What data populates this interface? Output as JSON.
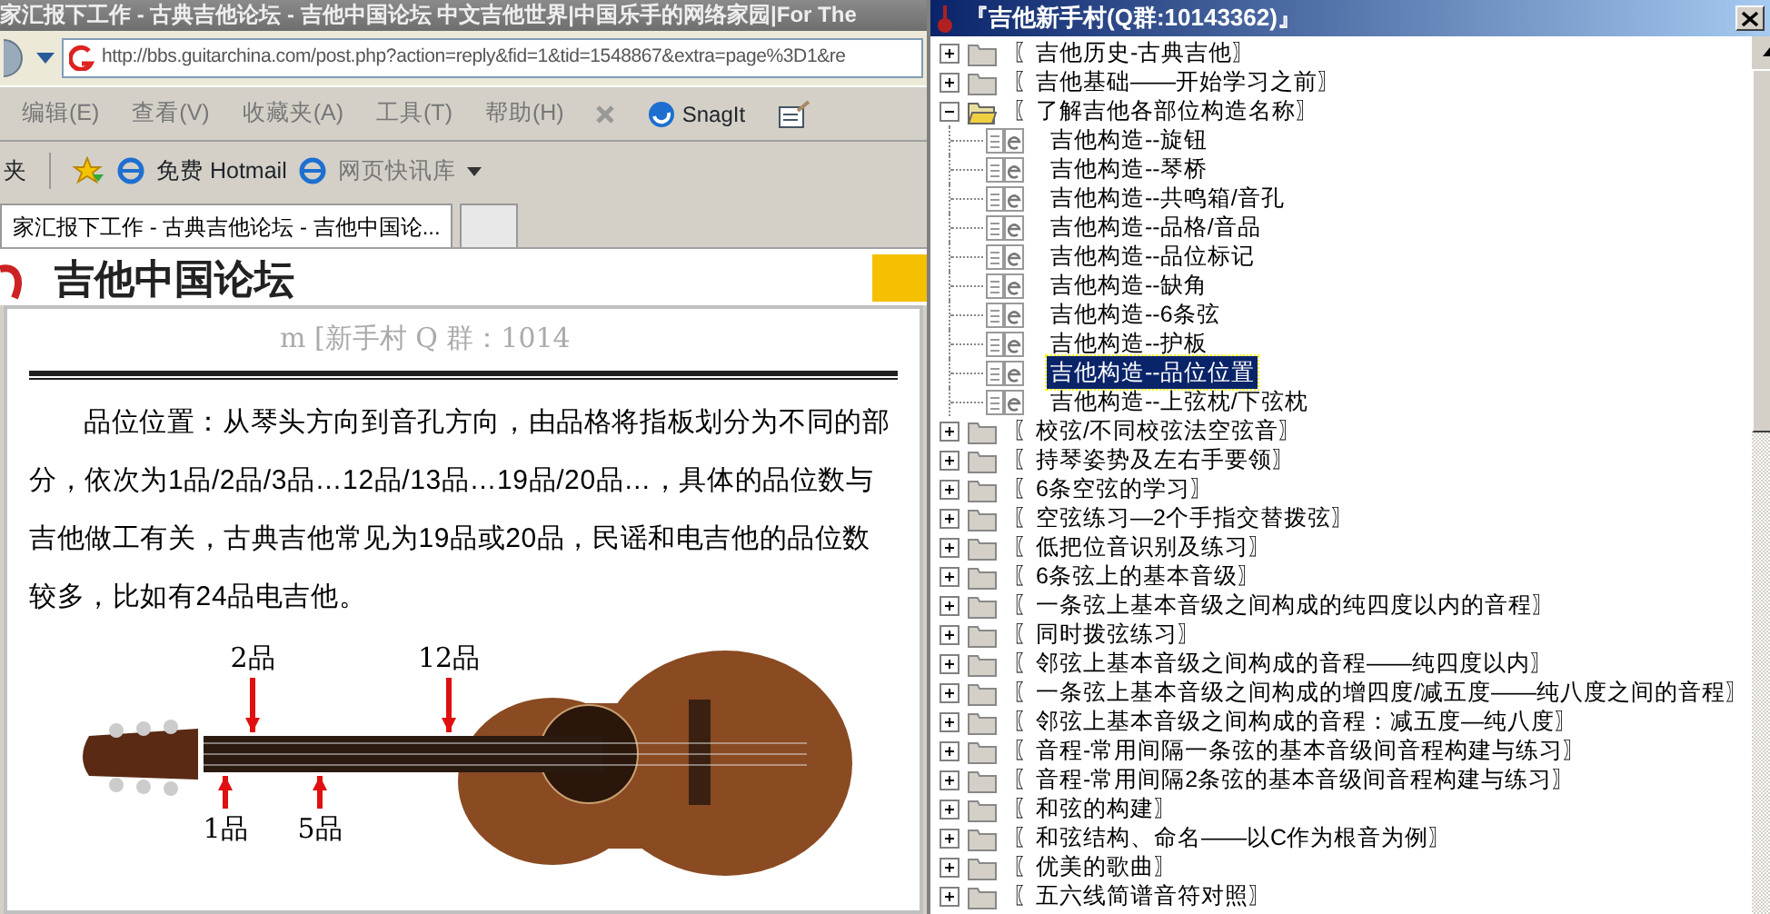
{
  "browser": {
    "title": "家汇报下工作 - 古典吉他论坛 - 吉他中国论坛 中文吉他世界|中国乐手的网络家园|For The",
    "address": "http://bbs.guitarchina.com/post.php?action=reply&fid=1&tid=1548867&extra=page%3D1&re",
    "menu": [
      "编辑(E)",
      "查看(V)",
      "收藏夹(A)",
      "工具(T)",
      "帮助(H)"
    ],
    "snagit": "SnagIt",
    "favorites_label": "夹",
    "favorites": [
      "免费 Hotmail",
      "网页快讯库"
    ],
    "tabs": [
      {
        "label": "家汇报下工作 - 古典吉他论坛 - 吉他中国论...",
        "selected": true
      }
    ],
    "page_heading": "吉他中国论坛"
  },
  "help_page": {
    "header": "m    [新手村 Q 群：1014",
    "paragraph": "品位位置：从琴头方向到音孔方向，由品格将指板划分为不同的部分，依次为1品/2品/3品…12品/13品…19品/20品…，具体的品位数与吉他做工有关，古典吉他常见为19品或20品，民谣和电吉他的品位数较多，比如有24品电吉他。",
    "fret_labels": [
      "2品",
      "12品",
      "1品",
      "5品"
    ]
  },
  "tree_window": {
    "title": "『吉他新手村(Q群:10143362)』",
    "items": [
      {
        "label": "〖吉他历史-古典吉他〗",
        "expanded": false
      },
      {
        "label": "〖吉他基础——开始学习之前〗",
        "expanded": false
      },
      {
        "label": "〖了解吉他各部位构造名称〗",
        "expanded": true,
        "children": [
          {
            "label": "吉他构造--旋钮",
            "selected": false
          },
          {
            "label": "吉他构造--琴桥",
            "selected": false
          },
          {
            "label": "吉他构造--共鸣箱/音孔",
            "selected": false
          },
          {
            "label": "吉他构造--品格/音品",
            "selected": false
          },
          {
            "label": "吉他构造--品位标记",
            "selected": false
          },
          {
            "label": "吉他构造--缺角",
            "selected": false
          },
          {
            "label": "吉他构造--6条弦",
            "selected": false
          },
          {
            "label": "吉他构造--护板",
            "selected": false
          },
          {
            "label": "吉他构造--品位位置",
            "selected": true
          },
          {
            "label": "吉他构造--上弦枕/下弦枕",
            "selected": false
          }
        ]
      },
      {
        "label": "〖校弦/不同校弦法空弦音〗",
        "expanded": false
      },
      {
        "label": "〖持琴姿势及左右手要领〗",
        "expanded": false
      },
      {
        "label": "〖6条空弦的学习〗",
        "expanded": false
      },
      {
        "label": "〖空弦练习—2个手指交替拨弦〗",
        "expanded": false
      },
      {
        "label": "〖低把位音识别及练习〗",
        "expanded": false
      },
      {
        "label": "〖6条弦上的基本音级〗",
        "expanded": false
      },
      {
        "label": "〖一条弦上基本音级之间构成的纯四度以内的音程〗",
        "expanded": false
      },
      {
        "label": "〖同时拨弦练习〗",
        "expanded": false
      },
      {
        "label": "〖邻弦上基本音级之间构成的音程——纯四度以内〗",
        "expanded": false
      },
      {
        "label": "〖一条弦上基本音级之间构成的增四度/减五度——纯八度之间的音程〗",
        "expanded": false
      },
      {
        "label": "〖邻弦上基本音级之间构成的音程：减五度—纯八度〗",
        "expanded": false
      },
      {
        "label": "〖音程-常用间隔一条弦的基本音级间音程构建与练习〗",
        "expanded": false
      },
      {
        "label": "〖音程-常用间隔2条弦的基本音级间音程构建与练习〗",
        "expanded": false
      },
      {
        "label": "〖和弦的构建〗",
        "expanded": false
      },
      {
        "label": "〖和弦结构、命名——以C作为根音为例〗",
        "expanded": false
      },
      {
        "label": "〖优美的歌曲〗",
        "expanded": false
      },
      {
        "label": "〖五六线简谱音符对照〗",
        "expanded": false
      }
    ]
  }
}
